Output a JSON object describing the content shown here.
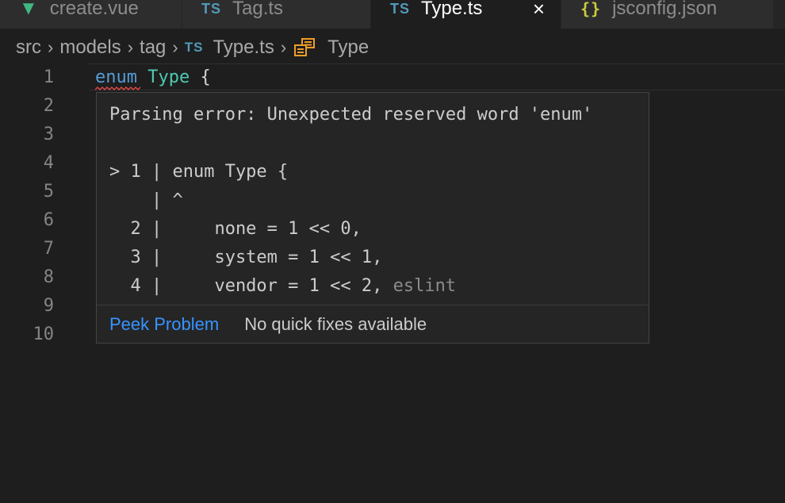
{
  "tabs": [
    {
      "label": "create.vue",
      "icon": "vue-icon",
      "active": false
    },
    {
      "label": "Tag.ts",
      "icon": "typescript-icon",
      "icon_text": "TS",
      "active": false
    },
    {
      "label": "Type.ts",
      "icon": "typescript-icon",
      "icon_text": "TS",
      "active": true,
      "close": "×"
    },
    {
      "label": "jsconfig.json",
      "icon": "json-icon",
      "icon_text": "{}",
      "active": false
    }
  ],
  "breadcrumb": {
    "items": [
      "src",
      "models",
      "tag",
      "Type.ts",
      "Type"
    ],
    "ts_icon_text": "TS"
  },
  "editor": {
    "line_numbers": [
      "1",
      "2",
      "3",
      "4",
      "5",
      "6",
      "7",
      "8",
      "9",
      "10"
    ],
    "line1": {
      "keyword": "enum",
      "name": "Type",
      "brace": "{"
    }
  },
  "hover": {
    "message": "Parsing error: Unexpected reserved word 'enum'",
    "frame_lines": [
      "> 1 | enum Type {",
      "    | ^",
      "  2 |     none = 1 << 0,",
      "  3 |     system = 1 << 1,",
      "  4 |     vendor = 1 << 2,"
    ],
    "source": "eslint",
    "peek_label": "Peek Problem",
    "no_fix_label": "No quick fixes available"
  },
  "colors": {
    "background": "#1e1e1e",
    "keyword": "#569cd6",
    "type": "#4ec9b0",
    "link": "#3794ff",
    "error": "#f14c4c",
    "enum_icon": "#ee9d28"
  }
}
